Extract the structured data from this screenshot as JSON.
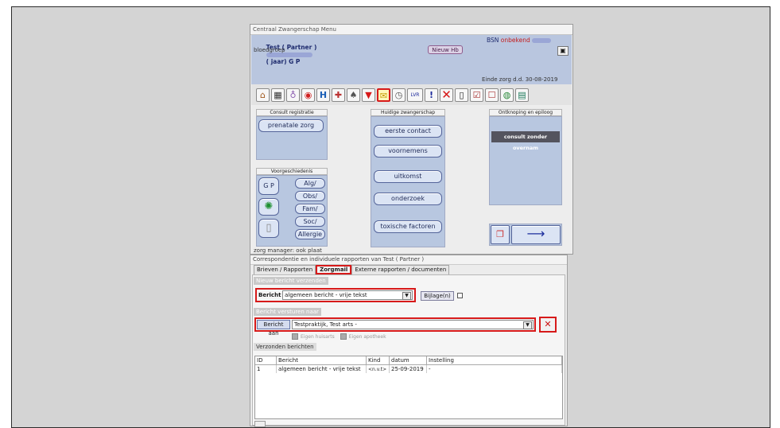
{
  "menu_window": {
    "title": "Centraal Zwangerschap Menu",
    "patient": {
      "name_prefix": "Test ( Partner )",
      "age_suffix": "( jaar) G P",
      "bsn_label": "BSN",
      "bsn_value": "onbekend",
      "blood_group_label": "bloedgroep",
      "new_hb_button": "Nieuw Hb",
      "care_end": "Einde zorg d.d. 30-08-2019"
    },
    "toolbar": {
      "lvr_label": "LVR",
      "exclaim_label": "!"
    },
    "columns": {
      "consult": {
        "header": "Consult registratie",
        "prenatal_button": "prenatale zorg",
        "history_header": "Voorgeschiedenis",
        "gp_button": "G P",
        "alg_button": "Alg/",
        "obs_button": "Obs/",
        "fam_button": "Fam/",
        "soc_button": "Soc/",
        "allergy_button": "Allergie"
      },
      "pregnancy": {
        "header": "Huidige zwangerschap",
        "first_contact_button": "eerste contact",
        "intentions_button": "voornemens",
        "outcome_button": "uitkomst",
        "research_button": "onderzoek",
        "toxic_button": "toxische factoren"
      },
      "outcome": {
        "header": "Ontknoping en epiloog",
        "consult_button": "consult zonder overnam"
      }
    },
    "footer_text": "zorg manager: ook plaat"
  },
  "corr_window": {
    "title": "Correspondentie en individuele rapporten van Test ( Partner )",
    "tabs": [
      "Brieven / Rapporten",
      "Zorgmail",
      "Externe rapporten / documenten"
    ],
    "new_message_section": "Nieuw bericht verzenden",
    "message_label": "Bericht",
    "message_value": "algemeen bericht - vrije tekst",
    "attachment_button": "Bijlage(n)",
    "send_to_section": "Bericht versturen naar",
    "send_to_button": "Bericht aan",
    "send_to_value": "Testpraktijk, Test arts -",
    "own_gp_label": "Eigen huisarts",
    "own_pharmacy_label": "Eigen apotheek",
    "sent_section": "Verzonden berichten",
    "sent_table": {
      "headers": [
        "ID",
        "Bericht",
        "Kind",
        "datum",
        "Instelling"
      ],
      "rows": [
        [
          "1",
          "algemeen bericht - vrije tekst",
          "<n.v.t>",
          "25-09-2019",
          "-"
        ]
      ]
    }
  }
}
